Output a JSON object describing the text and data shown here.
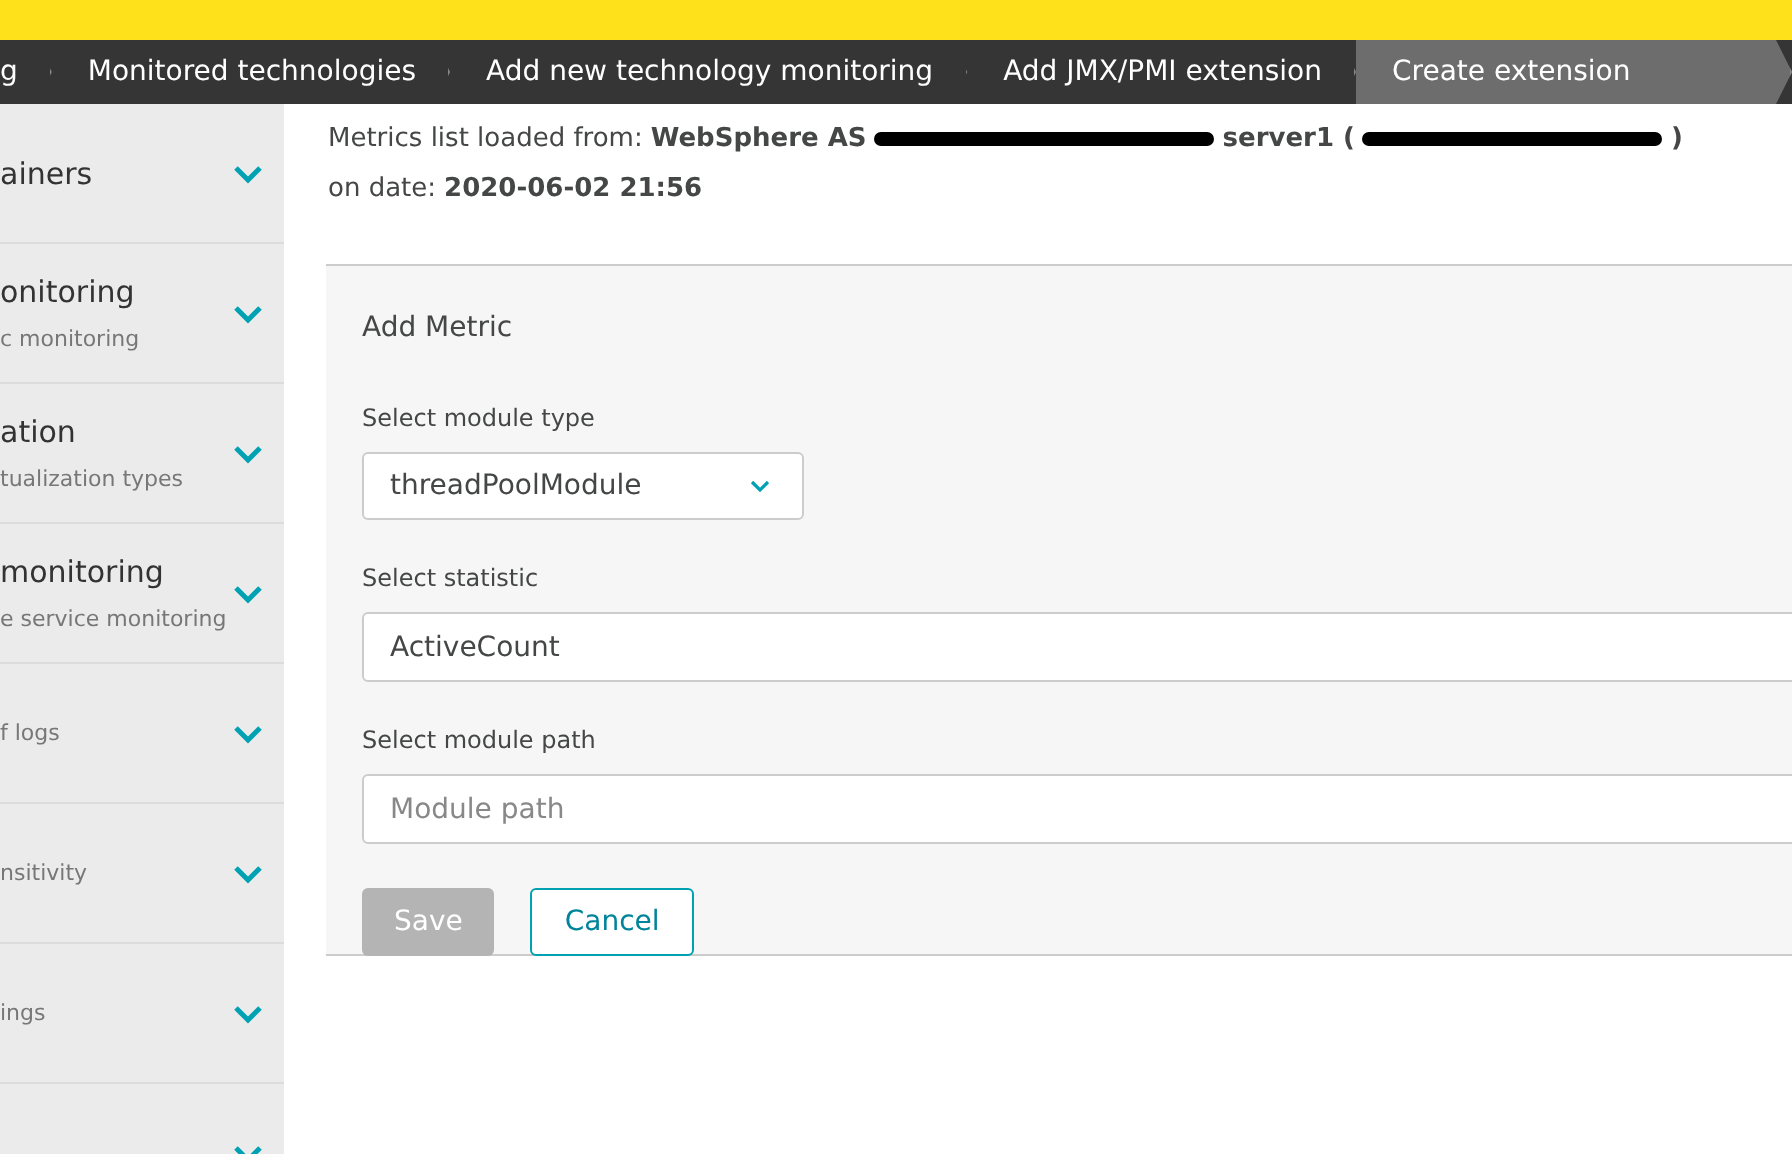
{
  "breadcrumbs": [
    {
      "label": "g",
      "selected": false
    },
    {
      "label": "Monitored technologies",
      "selected": false
    },
    {
      "label": "Add new technology monitoring",
      "selected": false
    },
    {
      "label": "Add JMX/PMI extension",
      "selected": false
    },
    {
      "label": "Create extension",
      "selected": true
    }
  ],
  "sidebar": {
    "items": [
      {
        "title": "ainers",
        "expanded": false
      },
      {
        "title": "onitoring",
        "subtitle": "c monitoring",
        "expanded": false
      },
      {
        "title": "ation",
        "subtitle": "tualization types",
        "expanded": false
      },
      {
        "title": "monitoring",
        "subtitle": "e service monitoring",
        "expanded": false
      },
      {
        "subtitle": "f logs",
        "expanded": false
      },
      {
        "subtitle": "nsitivity",
        "expanded": false
      },
      {
        "subtitle": "ings",
        "expanded": false
      },
      {
        "expanded": false
      }
    ]
  },
  "source": {
    "label": "Metrics list loaded from:",
    "host": "WebSphere AS",
    "server": "server1 (",
    "close": ")",
    "date_label": "on date:",
    "date": "2020-06-02 21:56"
  },
  "form": {
    "title": "Add Metric",
    "module_type": {
      "label": "Select module type",
      "value": "threadPoolModule"
    },
    "statistic": {
      "label": "Select statistic",
      "value": "ActiveCount"
    },
    "module_path": {
      "label": "Select module path",
      "placeholder": "Module path"
    },
    "buttons": [
      {
        "label": "Save",
        "kind": "primary",
        "disabled": true
      },
      {
        "label": "Cancel",
        "kind": "secondary",
        "disabled": false
      }
    ]
  }
}
